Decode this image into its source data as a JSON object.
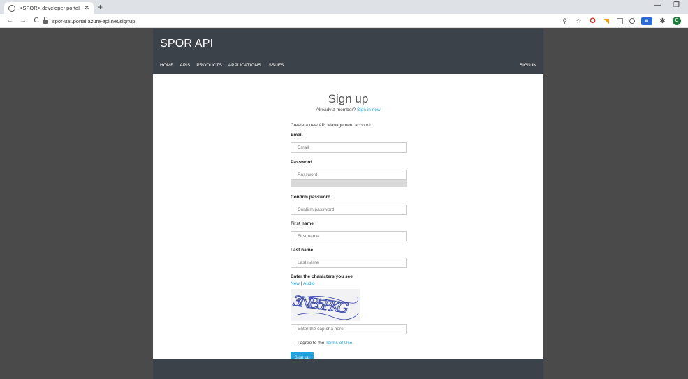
{
  "browser": {
    "tab_title": "<SPOR> developer portal",
    "url": "spor-uat.portal.azure-api.net/signup"
  },
  "header": {
    "brand": "SPOR API",
    "nav": [
      "HOME",
      "APIS",
      "PRODUCTS",
      "APPLICATIONS",
      "ISSUES"
    ],
    "sign_in": "SIGN IN"
  },
  "signup": {
    "title": "Sign up",
    "member_text": "Already a member?",
    "member_link": "Sign in now",
    "intro": "Create a new API Management account",
    "email_label": "Email",
    "email_placeholder": "Email",
    "password_label": "Password",
    "password_placeholder": "Password",
    "confirm_label": "Confirm password",
    "confirm_placeholder": "Confirm password",
    "first_label": "First name",
    "first_placeholder": "First name",
    "last_label": "Last name",
    "last_placeholder": "Last name",
    "captcha_label": "Enter the characters you see",
    "captcha_new": "New",
    "captcha_sep": "|",
    "captcha_audio": "Audio",
    "captcha_text": "3NB5PKG",
    "captcha_placeholder": "Enter the captcha here",
    "agree_text": "I agree to the",
    "terms_link": "Terms of Use.",
    "submit": "Sign up"
  },
  "colors": {
    "header_bg": "#3c4249",
    "accent": "#1fa3e0",
    "backdrop": "#4a4a4a"
  }
}
